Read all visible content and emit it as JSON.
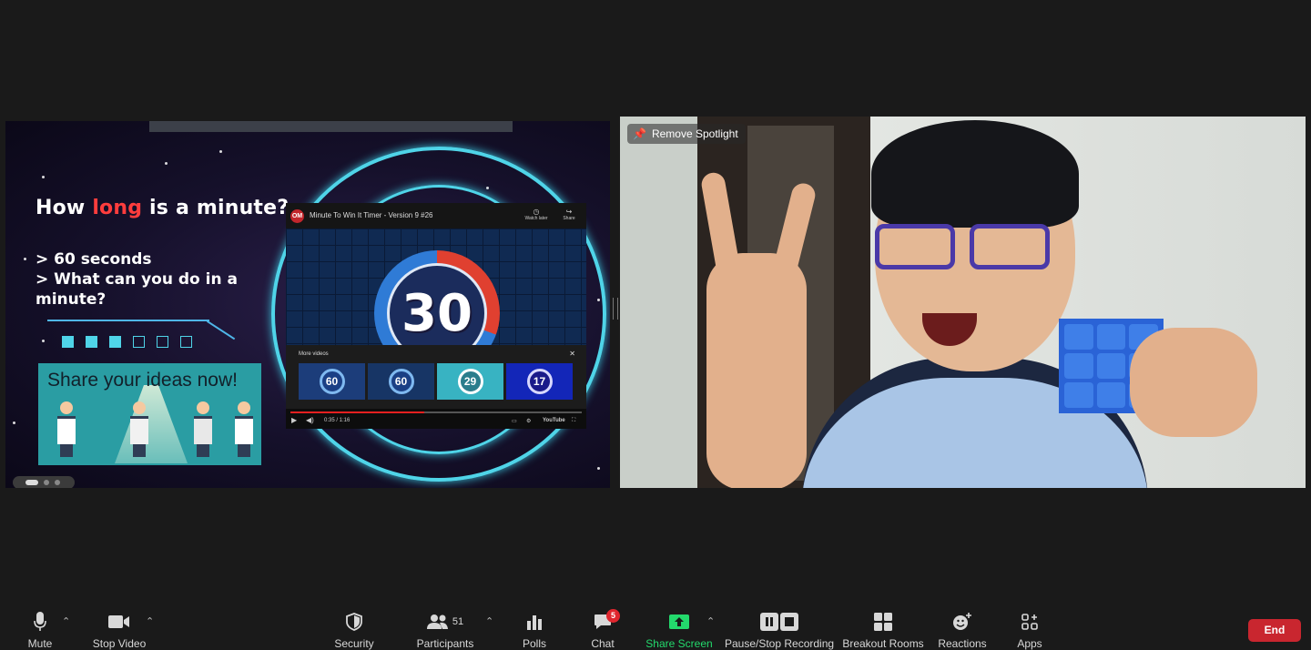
{
  "slide": {
    "title_part1": "How ",
    "title_highlight": "long",
    "title_part2": " is a minute?",
    "bullet1": "> 60 seconds",
    "bullet2": "> What can you do in a minute?",
    "ideas_text": "Share your ideas now!"
  },
  "video": {
    "channel_logo": "OM",
    "title": "Minute To Win It Timer - Version 9 #26",
    "watch_later": "Watch later",
    "share": "Share",
    "timer_value": "30",
    "more_videos": "More videos",
    "thumbnails": [
      "60",
      "60",
      "29",
      "17"
    ],
    "time": "0:35 / 1:16",
    "platform": "YouTube",
    "progress": 0.46
  },
  "spotlight": {
    "remove_label": "Remove Spotlight"
  },
  "toolbar": {
    "mute": "Mute",
    "stop_video": "Stop Video",
    "security": "Security",
    "participants": "Participants",
    "participants_count": "51",
    "polls": "Polls",
    "chat": "Chat",
    "chat_badge": "5",
    "share_screen": "Share Screen",
    "pause_recording": "Pause/Stop Recording",
    "breakout_rooms": "Breakout Rooms",
    "reactions": "Reactions",
    "apps": "Apps",
    "end": "End"
  },
  "colors": {
    "accent_cyan": "#4fd4e8",
    "share_green": "#23d96c",
    "end_red": "#c9262f",
    "badge_red": "#e0262e"
  }
}
